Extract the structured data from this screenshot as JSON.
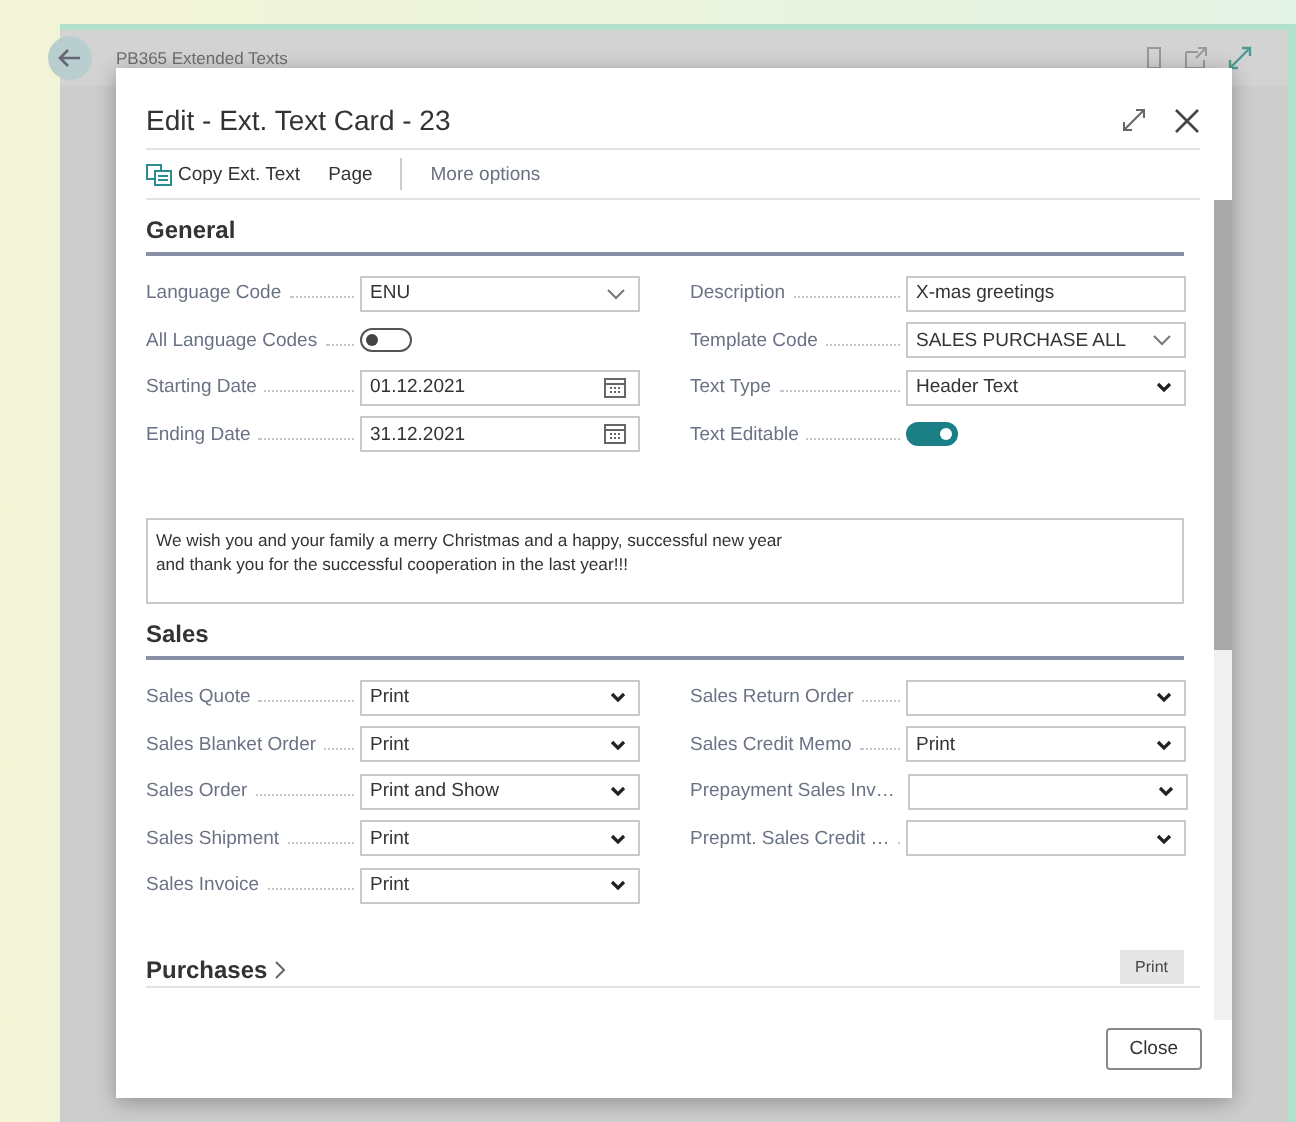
{
  "background_page": {
    "title": "PB365 Extended Texts"
  },
  "dialog": {
    "title": "Edit - Ext. Text Card - 23",
    "actions": [
      {
        "label": "Copy Ext. Text",
        "kind": "icon"
      },
      {
        "label": "Page",
        "kind": "plain"
      },
      {
        "label": "More options",
        "kind": "more"
      }
    ],
    "general": {
      "title": "General",
      "left_fields": [
        {
          "label": "Language Code",
          "kind": "combo",
          "value": "ENU"
        },
        {
          "label": "All Language Codes",
          "kind": "toggle",
          "on": false
        },
        {
          "label": "Starting Date",
          "kind": "date",
          "value": "01.12.2021"
        },
        {
          "label": "Ending Date",
          "kind": "date",
          "value": "31.12.2021"
        }
      ],
      "right_fields": [
        {
          "label": "Description",
          "kind": "text",
          "value": "X-mas greetings"
        },
        {
          "label": "Template Code",
          "kind": "combo",
          "value": "SALES PURCHASE ALL"
        },
        {
          "label": "Text Type",
          "kind": "dropdown",
          "value": "Header Text"
        },
        {
          "label": "Text Editable",
          "kind": "toggle",
          "on": true
        }
      ],
      "text_lines": [
        "We wish you and your family a merry Christmas and a happy, successful new year",
        "and thank you for the successful cooperation in the last year!!!"
      ]
    },
    "sales": {
      "title": "Sales",
      "left_fields": [
        {
          "label": "Sales Quote",
          "kind": "dropdown",
          "value": "Print"
        },
        {
          "label": "Sales Blanket Order",
          "kind": "dropdown",
          "value": "Print"
        },
        {
          "label": "Sales Order",
          "kind": "dropdown",
          "value": "Print and Show"
        },
        {
          "label": "Sales Shipment",
          "kind": "dropdown",
          "value": "Print"
        },
        {
          "label": "Sales Invoice",
          "kind": "dropdown",
          "value": "Print"
        }
      ],
      "right_fields": [
        {
          "label": "Sales Return Order",
          "kind": "dropdown"
        },
        {
          "label": "Sales Credit Memo",
          "kind": "dropdown",
          "value": "Print"
        },
        {
          "label": "Prepayment Sales Inv…",
          "kind": "dropdown"
        },
        {
          "label": "Prepmt. Sales Credit …",
          "kind": "dropdown"
        }
      ]
    },
    "purchases": {
      "title": "Purchases",
      "partial_button": "Print"
    },
    "buttons": [
      "Close"
    ]
  }
}
